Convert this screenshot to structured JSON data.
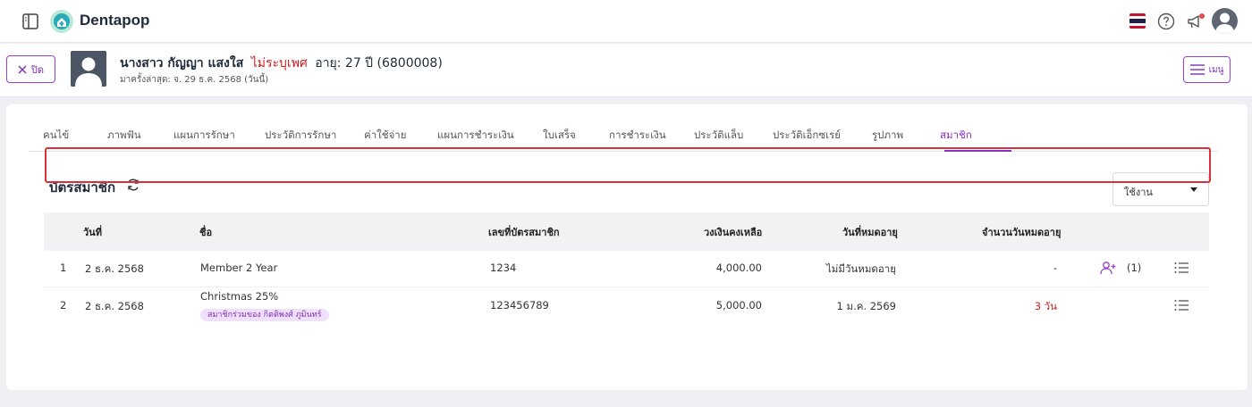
{
  "app": {
    "brand": "Dentapop",
    "brand_color": "#1f2a3a",
    "accent": "#8a2fc9"
  },
  "header": {
    "icons": [
      "sidebar-toggle-icon",
      "thai-flag-icon",
      "help-icon",
      "announcement-icon",
      "user-avatar"
    ]
  },
  "patient": {
    "close_label": "ปิด",
    "name": "นางสาว กัญญา แสงใส",
    "gender": "ไม่ระบุเพศ",
    "age": "อายุ: 27 ปี (6800008)",
    "last_visit": "มาครั้งล่าสุด: จ. 29 ธ.ค. 2568 (วันนี้)",
    "menu_label": "เมนู"
  },
  "tabs": [
    {
      "label": "คนไข้"
    },
    {
      "label": "ภาพฟัน"
    },
    {
      "label": "แผนการรักษา"
    },
    {
      "label": "ประวัติการรักษา"
    },
    {
      "label": "ค่าใช้จ่าย"
    },
    {
      "label": "แผนการชำระเงิน"
    },
    {
      "label": "ใบเสร็จ"
    },
    {
      "label": "การชำระเงิน"
    },
    {
      "label": "ประวัติแล็บ"
    },
    {
      "label": "ประวัติเอ็กซเรย์"
    },
    {
      "label": "รูปภาพ"
    },
    {
      "label": "สมาชิก",
      "active": true
    }
  ],
  "section": {
    "title": "บัตรสมาชิก",
    "status_filter": "ใช้งาน"
  },
  "table": {
    "columns": [
      "วันที่",
      "ชื่อ",
      "เลขที่บัตรสมาชิก",
      "วงเงินคงเหลือ",
      "วันที่หมดอายุ",
      "จำนวนวันหมดอายุ"
    ],
    "rows": [
      {
        "index": "1",
        "date": "2 ธ.ค. 2568",
        "name": "Member 2 Year",
        "badge": "",
        "card_no": "1234",
        "balance": "4,000.00",
        "expiry": "ไม่มีวันหมดอายุ",
        "days_left": "-",
        "members": "(1)"
      },
      {
        "index": "2",
        "date": "2 ธ.ค. 2568",
        "name": "Christmas 25%",
        "badge": "สมาชิกร่วมของ กิตติพงศ์ ภูมินทร์",
        "card_no": "123456789",
        "balance": "5,000.00",
        "expiry": "1 ม.ค. 2569",
        "days_left": "3 วัน",
        "members": ""
      }
    ]
  }
}
